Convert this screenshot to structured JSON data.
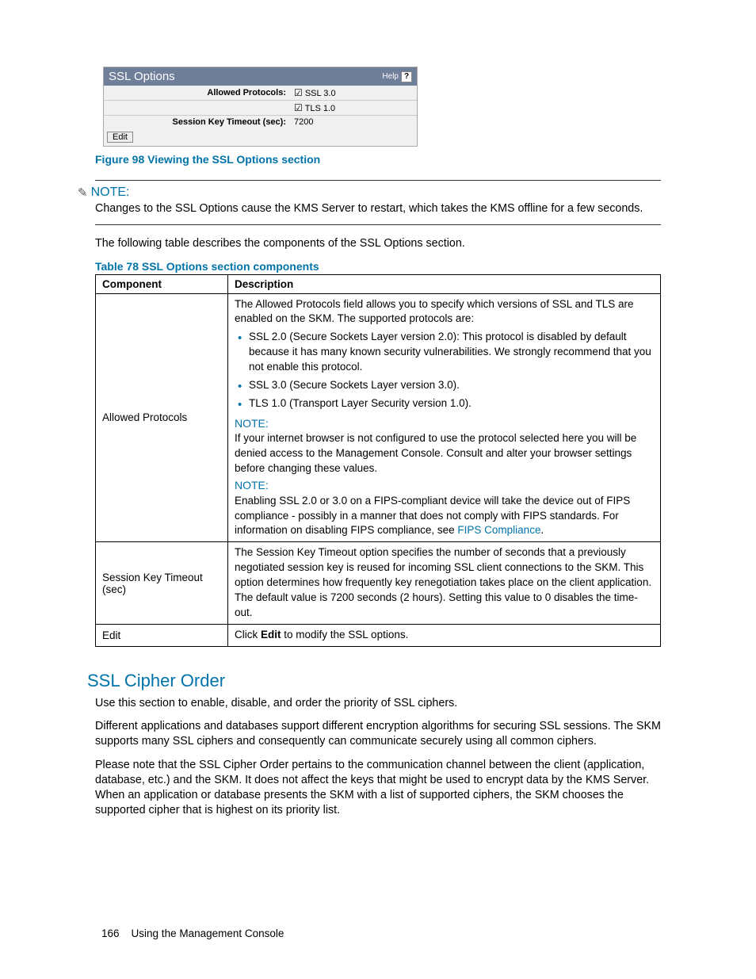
{
  "screenshot": {
    "title": "SSL Options",
    "help": "Help",
    "rows": {
      "allowed_label": "Allowed Protocols:",
      "ssl30": "SSL 3.0",
      "tls10": "TLS 1.0",
      "timeout_label": "Session Key Timeout (sec):",
      "timeout_value": "7200"
    },
    "edit": "Edit"
  },
  "figure_caption": "Figure 98 Viewing the SSL Options section",
  "note1": {
    "label": "NOTE:",
    "text": "Changes to the SSL Options cause the KMS Server to restart, which takes the KMS offline for a few seconds."
  },
  "intro_text": "The following table describes the components of the SSL Options section.",
  "table_caption": "Table 78 SSL Options section components",
  "table": {
    "headers": {
      "component": "Component",
      "description": "Description"
    },
    "rows": [
      {
        "component": "Allowed Protocols",
        "desc_intro": "The Allowed Protocols field allows you to specify which versions of SSL and TLS are enabled on the SKM. The supported protocols are:",
        "bullets": [
          "SSL 2.0 (Secure Sockets Layer version 2.0): This protocol is disabled by default because it has many known security vulnerabilities. We strongly recommend that you not enable this protocol.",
          "SSL 3.0 (Secure Sockets Layer version 3.0).",
          "TLS 1.0 (Transport Layer Security version 1.0)."
        ],
        "note_a_label": "NOTE:",
        "note_a_text": "If your internet browser is not configured to use the protocol selected here you will be denied access to the Management Console. Consult and alter your browser settings before changing these values.",
        "note_b_label": "NOTE:",
        "note_b_text_prefix": "Enabling SSL 2.0 or 3.0 on a FIPS-compliant device will take the device out of FIPS compliance - possibly in a manner that does not comply with FIPS standards. For information on disabling FIPS compliance, see ",
        "note_b_link": "FIPS Compliance",
        "note_b_text_suffix": "."
      },
      {
        "component": "Session Key Timeout (sec)",
        "description": "The Session Key Timeout option specifies the number of seconds that a previously negotiated session key is reused for incoming SSL client connections to the SKM. This option determines how frequently key renegotiation takes place on the client application. The default value is 7200 seconds (2 hours). Setting this value to 0 disables the time-out."
      },
      {
        "component": "Edit",
        "desc_prefix": "Click ",
        "desc_bold": "Edit",
        "desc_suffix": " to modify the SSL options."
      }
    ]
  },
  "section": {
    "heading": "SSL Cipher Order",
    "p1": "Use this section to enable, disable, and order the priority of SSL ciphers.",
    "p2": "Different applications and databases support different encryption algorithms for securing SSL sessions. The SKM supports many SSL ciphers and consequently can communicate securely using all common ciphers.",
    "p3": "Please note that the SSL Cipher Order pertains to the communication channel between the client (application, database, etc.) and the SKM. It does not affect the keys that might be used to encrypt data by the KMS Server. When an application or database presents the SKM with a list of supported ciphers, the SKM chooses the supported cipher that is highest on its priority list."
  },
  "footer": {
    "page": "166",
    "title": "Using the Management Console"
  }
}
